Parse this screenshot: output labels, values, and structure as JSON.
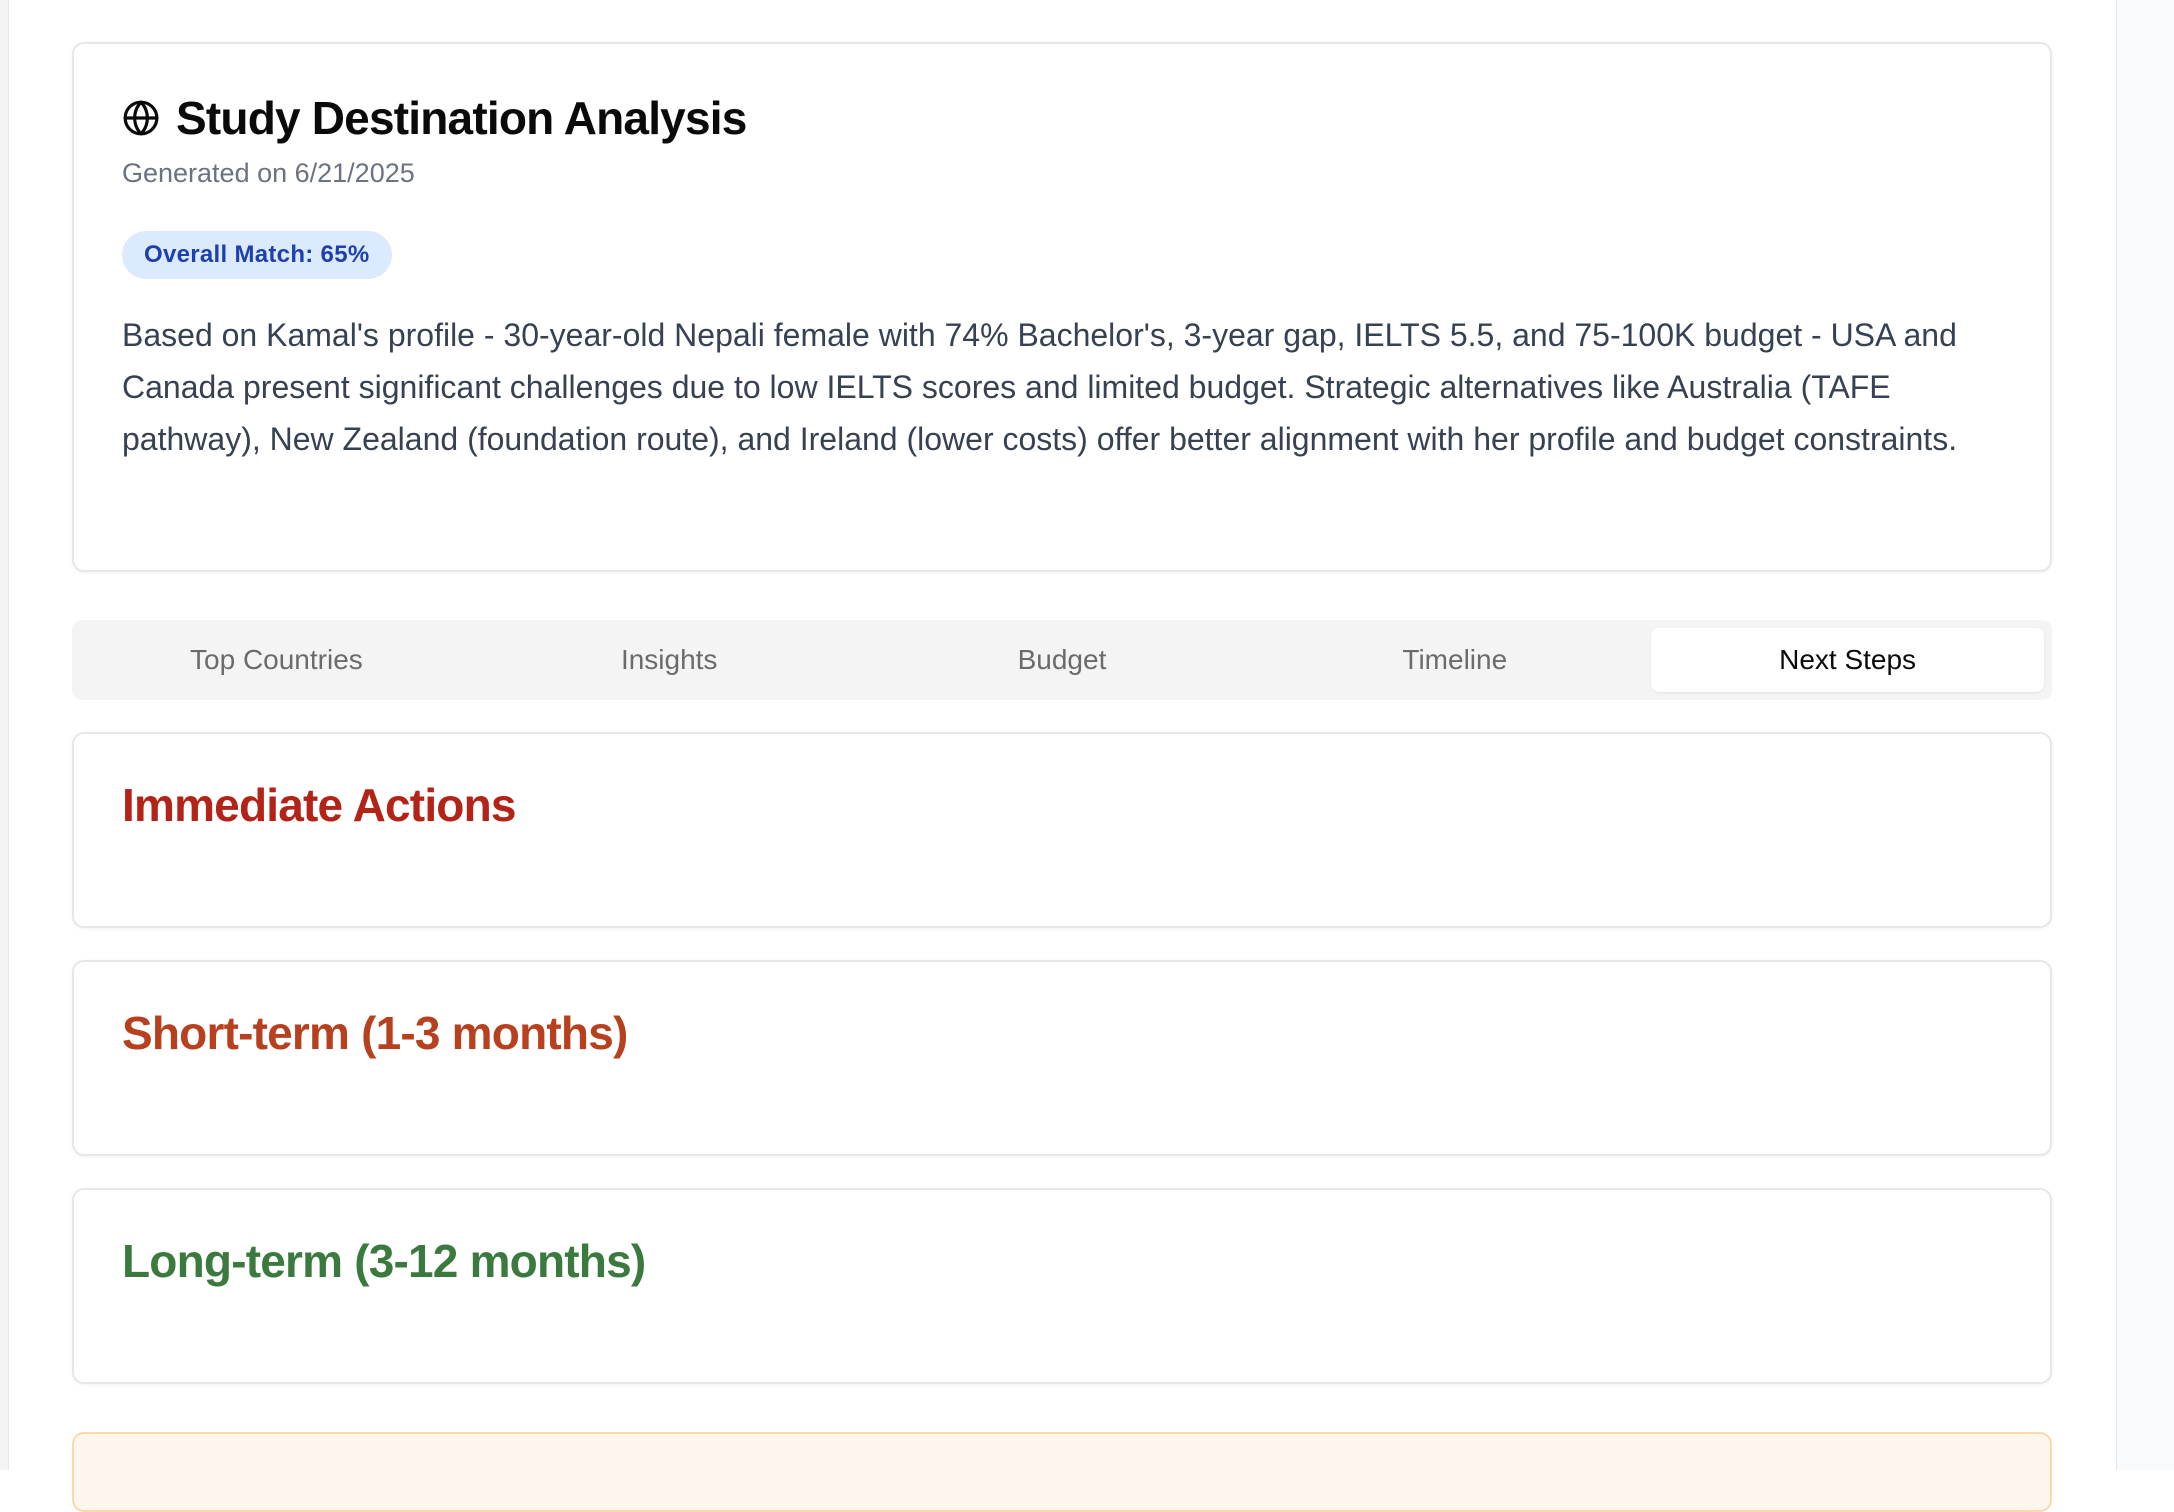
{
  "summary": {
    "title": "Study Destination Analysis",
    "icon": "globe-icon",
    "generated": "Generated on 6/21/2025",
    "match_badge": "Overall Match: 65%",
    "overall_match_percent": 65,
    "text": "Based on Kamal's profile - 30-year-old Nepali female with 74% Bachelor's, 3-year gap, IELTS 5.5, and 75-100K budget - USA and Canada present significant challenges due to low IELTS scores and limited budget. Strategic alternatives like Australia (TAFE pathway), New Zealand (foundation route), and Ireland (lower costs) offer better alignment with her profile and budget constraints."
  },
  "tabs": [
    {
      "label": "Top Countries",
      "active": false
    },
    {
      "label": "Insights",
      "active": false
    },
    {
      "label": "Budget",
      "active": false
    },
    {
      "label": "Timeline",
      "active": false
    },
    {
      "label": "Next Steps",
      "active": true
    }
  ],
  "next_steps": [
    {
      "title": "Immediate Actions",
      "color": "#b42318"
    },
    {
      "title": "Short-term (1-3 months)",
      "color": "#b7411f"
    },
    {
      "title": "Long-term (3-12 months)",
      "color": "#3b7a3e"
    }
  ],
  "colors": {
    "badge_bg": "#dbeafe",
    "badge_text": "#1e40af",
    "notice_bg": "#fff7ed"
  }
}
